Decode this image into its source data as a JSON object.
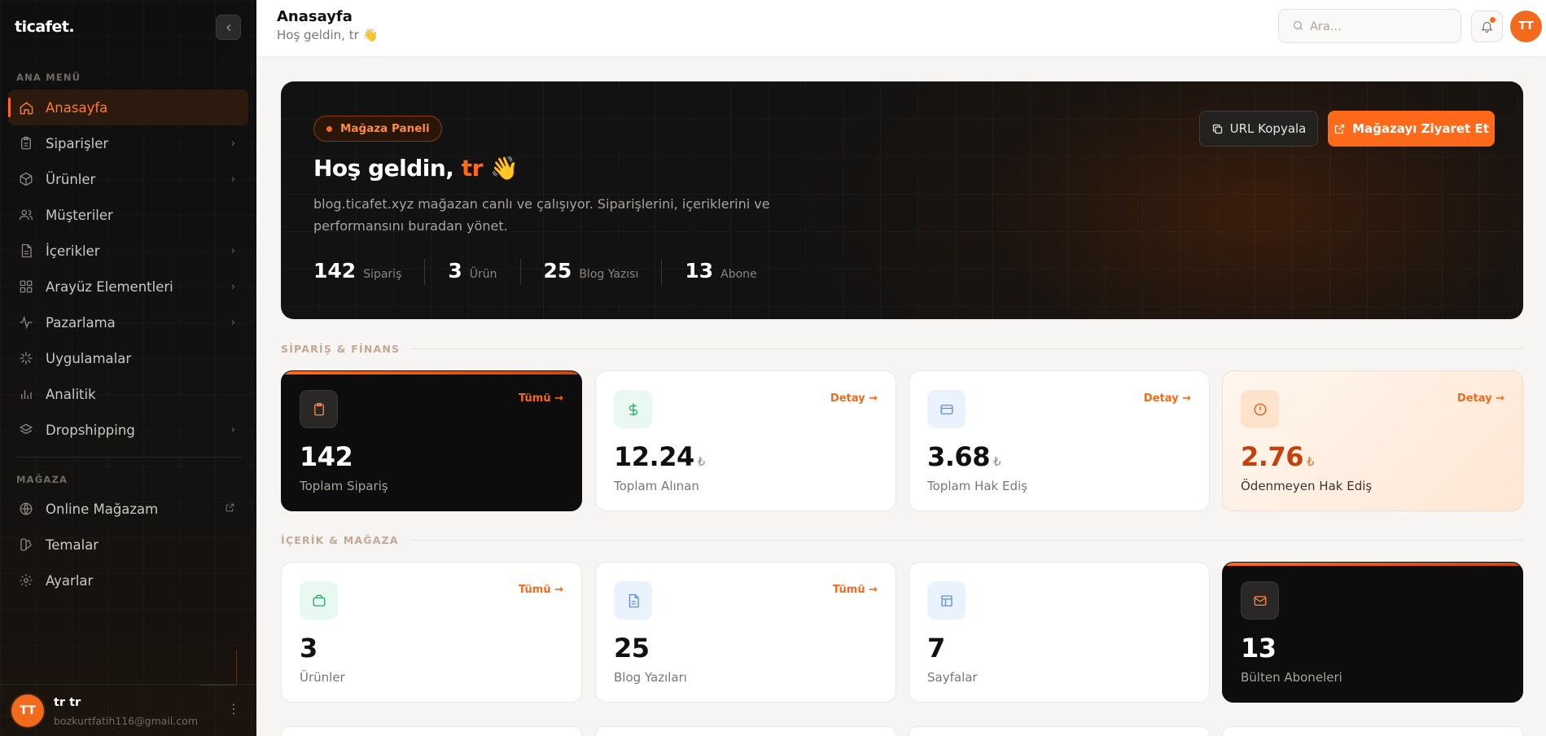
{
  "sidebar": {
    "logo": "ticafet.",
    "main_section": "ANA MENÜ",
    "main_items": [
      {
        "label": "Anasayfa",
        "icon": "home-icon"
      },
      {
        "label": "Siparişler",
        "icon": "clipboard-icon"
      },
      {
        "label": "Ürünler",
        "icon": "box-icon"
      },
      {
        "label": "Müşteriler",
        "icon": "users-icon"
      },
      {
        "label": "İçerikler",
        "icon": "file-icon"
      },
      {
        "label": "Arayüz Elementleri",
        "icon": "grid-icon"
      },
      {
        "label": "Pazarlama",
        "icon": "activity-icon"
      },
      {
        "label": "Uygulamalar",
        "icon": "sparkle-icon"
      },
      {
        "label": "Analitik",
        "icon": "bar-chart-icon"
      },
      {
        "label": "Dropshipping",
        "icon": "layers-icon"
      }
    ],
    "store_section": "MAĞAZA",
    "store_items": [
      {
        "label": "Online Mağazam",
        "icon": "globe-icon"
      },
      {
        "label": "Temalar",
        "icon": "palette-icon"
      },
      {
        "label": "Ayarlar",
        "icon": "gear-icon"
      }
    ],
    "user": {
      "initials": "TT",
      "name": "tr tr",
      "email": "bozkurtfatih116@gmail.com"
    }
  },
  "topbar": {
    "title": "Anasayfa",
    "subtitle": "Hoş geldin, tr 👋",
    "search_placeholder": "Ara...",
    "avatar_initials": "TT"
  },
  "hero": {
    "badge": "Mağaza Paneli",
    "title_prefix": "Hoş geldin, ",
    "title_name": "tr",
    "title_emoji": "👋",
    "description": "blog.ticafet.xyz mağazan canlı ve çalışıyor. Siparişlerini, içeriklerini ve performansını buradan yönet.",
    "copy_button": "URL Kopyala",
    "visit_button": "Mağazayı Ziyaret Et",
    "stats": [
      {
        "value": "142",
        "label": "Sipariş"
      },
      {
        "value": "3",
        "label": "Ürün"
      },
      {
        "value": "25",
        "label": "Blog Yazısı"
      },
      {
        "value": "13",
        "label": "Abone"
      }
    ]
  },
  "finance": {
    "heading": "SİPARİŞ & FİNANS",
    "cards": [
      {
        "value": "142",
        "currency": "",
        "label": "Toplam Sipariş",
        "link": "Tümü →"
      },
      {
        "value": "12.24",
        "currency": "₺",
        "label": "Toplam Alınan",
        "link": "Detay →"
      },
      {
        "value": "3.68",
        "currency": "₺",
        "label": "Toplam Hak Ediş",
        "link": "Detay →"
      },
      {
        "value": "2.76",
        "currency": "₺",
        "label": "Ödenmeyen Hak Ediş",
        "link": "Detay →"
      }
    ]
  },
  "content": {
    "heading": "İÇERİK & MAĞAZA",
    "cards": [
      {
        "value": "3",
        "label": "Ürünler",
        "link": "Tümü →"
      },
      {
        "value": "25",
        "label": "Blog Yazıları",
        "link": "Tümü →"
      },
      {
        "value": "7",
        "label": "Sayfalar",
        "link": ""
      },
      {
        "value": "13",
        "label": "Bülten Aboneleri",
        "link": ""
      }
    ]
  },
  "colors": {
    "accent": "#ff6a1a",
    "dark": "#0d0d0d",
    "warn": "#c2410c"
  }
}
